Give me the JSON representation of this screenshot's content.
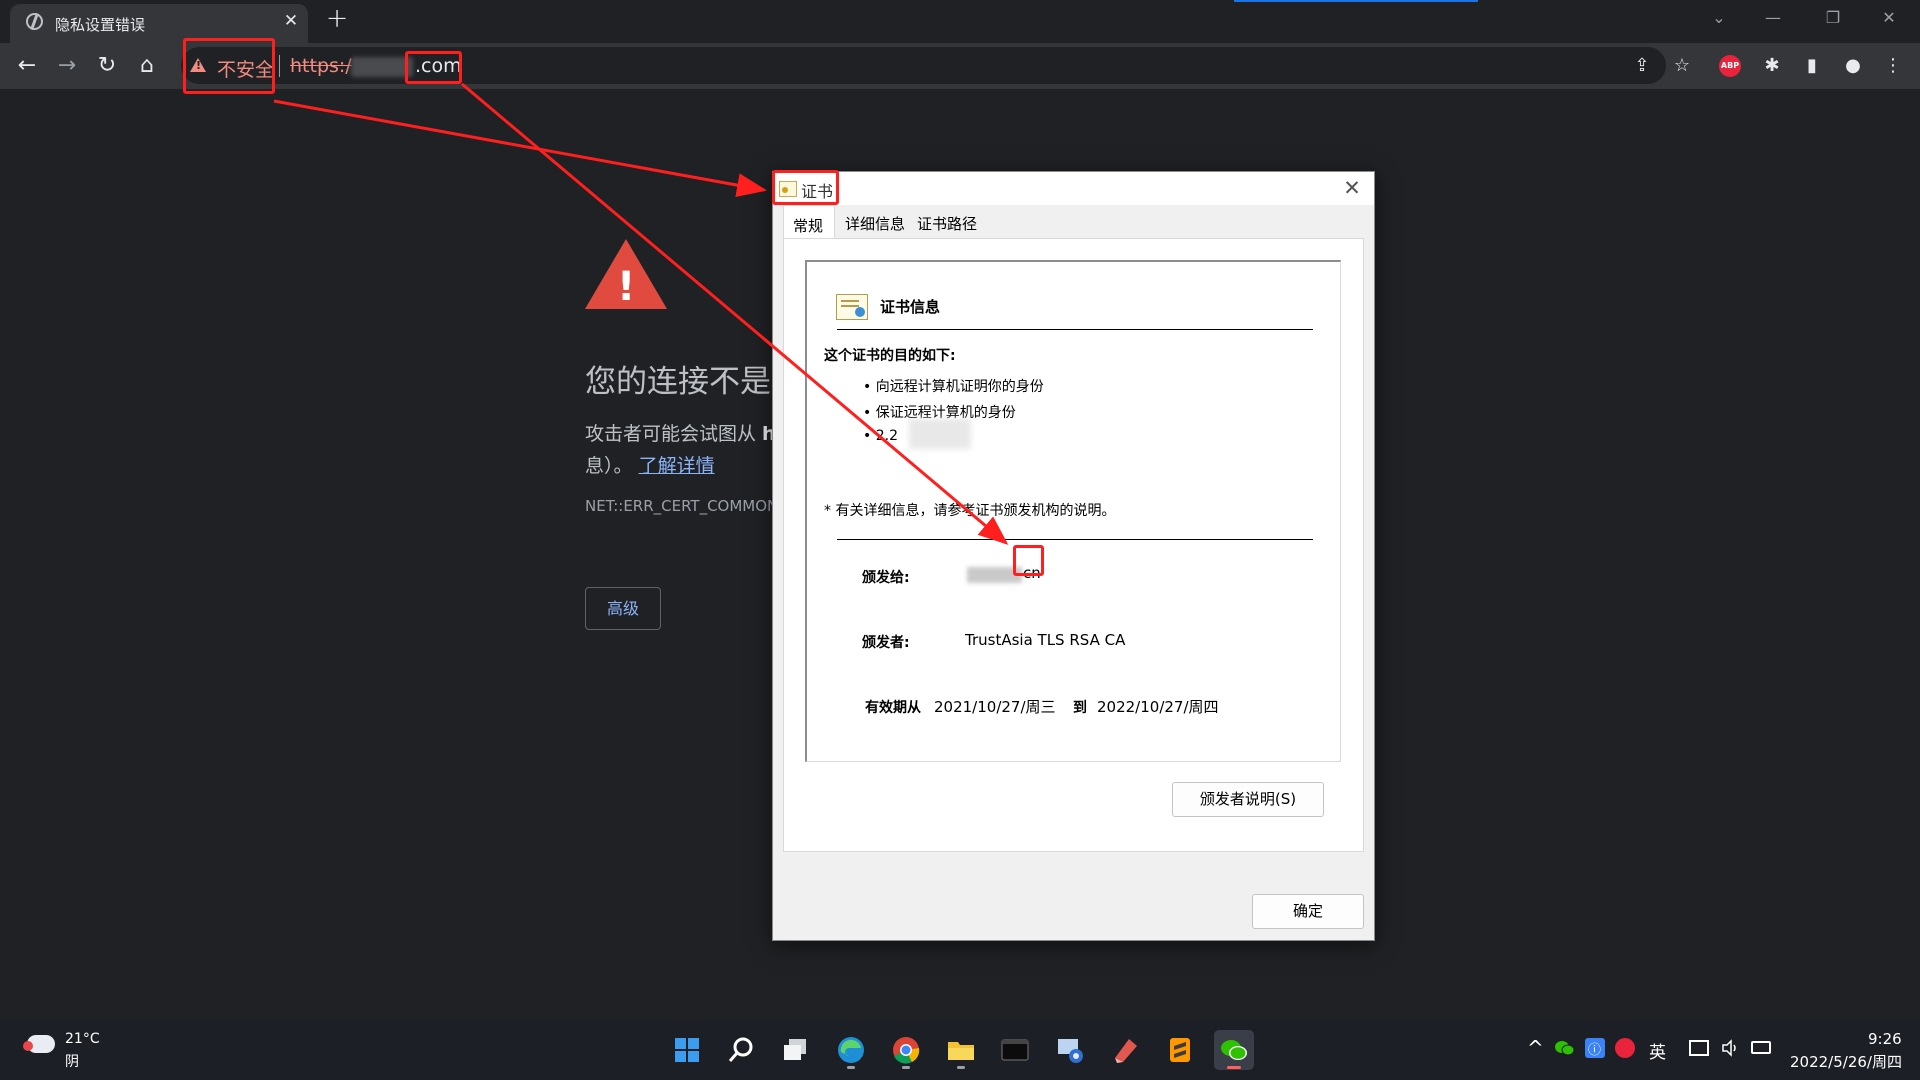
{
  "browser": {
    "tab_title": "隐私设置错误",
    "tab_close": "✕",
    "new_tab": "+",
    "tab_search": "⌄",
    "window_controls": {
      "minimize": "—",
      "restore": "❐",
      "close": "✕"
    },
    "toolbar": {
      "back": "←",
      "forward": "→",
      "reload": "↻",
      "home": "⌂"
    },
    "security_label": "不安全",
    "url_scheme": "https:/",
    "url_tld": ".com",
    "share": "⇪",
    "bookmark": "☆",
    "abp_label": "ABP",
    "extensions": "✱",
    "sidepanel": "▮",
    "profile": "●",
    "menu": "⋮"
  },
  "error_page": {
    "heading": "您的连接不是私",
    "body_line1": "攻击者可能会试图从 ",
    "body_bold": "h",
    "body_line2": "息）。",
    "learn_more": "了解详情",
    "error_code": "NET::ERR_CERT_COMMON_N",
    "advanced_button": "高级"
  },
  "cert_dialog": {
    "title": "证书",
    "close": "✕",
    "tabs": [
      "常规",
      "详细信息",
      "证书路径"
    ],
    "info_heading": "证书信息",
    "purpose_heading": "这个证书的目的如下:",
    "purposes": [
      "• 向远程计算机证明你的身份",
      "• 保证远程计算机的身份",
      "• 2.2"
    ],
    "note": "* 有关详细信息，请参考证书颁发机构的说明。",
    "issued_to_label": "颁发给:",
    "issued_to_value": "cn",
    "issued_by_label": "颁发者:",
    "issued_by_value": "TrustAsia TLS RSA CA",
    "validity_label": "有效期从",
    "valid_from": "2021/10/27/周三",
    "valid_to_label": "到",
    "valid_to": "2022/10/27/周四",
    "issuer_statement_button": "颁发者说明(S)",
    "ok_button": "确定"
  },
  "taskbar": {
    "temperature": "21°C",
    "condition": "阴",
    "apps": [
      "start-icon",
      "search-icon",
      "task-view-icon",
      "edge-icon",
      "chrome-icon",
      "file-explorer-icon",
      "terminal-icon",
      "network-tool-icon",
      "pdf-tool-icon",
      "sublime-text-icon",
      "wechat-icon"
    ],
    "tray": {
      "overflow": "^",
      "ime_mode": "英",
      "input_label": "ⓘ"
    },
    "time": "9:26",
    "date": "2022/5/26/周四"
  },
  "colors": {
    "annotation_red": "#ff1f1f",
    "warning_red": "#f28b82",
    "link_blue": "#8ab4f8"
  }
}
